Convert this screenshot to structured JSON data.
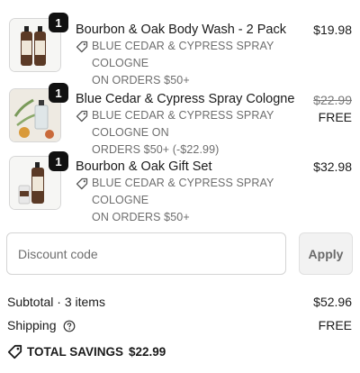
{
  "items": [
    {
      "name": "Bourbon & Oak Body Wash - 2 Pack",
      "quantity": "1",
      "discount_lines": [
        "BLUE CEDAR & CYPRESS SPRAY COLOGNE",
        "ON ORDERS $50+"
      ],
      "price": "$19.98",
      "thumb_icon": "body-wash-bottles-image"
    },
    {
      "name": "Blue Cedar & Cypress Spray Cologne",
      "quantity": "1",
      "discount_lines": [
        "BLUE CEDAR & CYPRESS SPRAY COLOGNE ON",
        "ORDERS $50+ (-$22.99)"
      ],
      "original_price": "$22.99",
      "price": "FREE",
      "thumb_icon": "cologne-spray-image"
    },
    {
      "name": "Bourbon & Oak Gift Set",
      "quantity": "1",
      "discount_lines": [
        "BLUE CEDAR & CYPRESS SPRAY COLOGNE",
        "ON ORDERS $50+"
      ],
      "price": "$32.98",
      "thumb_icon": "gift-set-image"
    }
  ],
  "discount": {
    "placeholder": "Discount code",
    "apply_label": "Apply"
  },
  "summary": {
    "subtotal_label": "Subtotal · 3 items",
    "subtotal_value": "$52.96",
    "shipping_label": "Shipping",
    "shipping_value": "FREE",
    "savings_label": "TOTAL SAVINGS",
    "savings_value": "$22.99"
  },
  "colors": {
    "text": "#1a1a1a",
    "muted": "#6e6e6e",
    "badge": "#111111",
    "apply_bg": "#f2f2f2"
  }
}
